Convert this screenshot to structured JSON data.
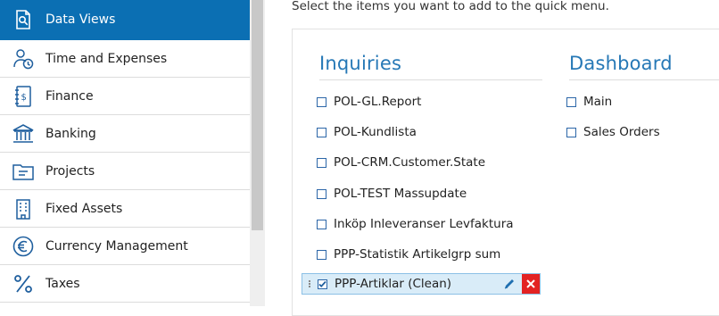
{
  "sidebar": {
    "items": [
      {
        "label": "Data Views",
        "icon": "data-views-icon",
        "active": true
      },
      {
        "label": "Time and Expenses",
        "icon": "time-expenses-icon"
      },
      {
        "label": "Finance",
        "icon": "finance-icon"
      },
      {
        "label": "Banking",
        "icon": "bank-icon"
      },
      {
        "label": "Projects",
        "icon": "projects-icon"
      },
      {
        "label": "Fixed Assets",
        "icon": "building-icon"
      },
      {
        "label": "Currency Management",
        "icon": "euro-icon"
      },
      {
        "label": "Taxes",
        "icon": "percent-icon"
      }
    ],
    "accent": "#0b6fb3"
  },
  "main": {
    "instruction": "Select the items you want to add to the quick menu.",
    "inquiries": {
      "title": "Inquiries",
      "items": [
        {
          "label": "POL-GL.Report",
          "checked": false
        },
        {
          "label": "POL-Kundlista",
          "checked": false
        },
        {
          "label": "POL-CRM.Customer.State",
          "checked": false
        },
        {
          "label": "POL-TEST Massupdate",
          "checked": false
        },
        {
          "label": "Inköp Inleveranser Levfaktura",
          "checked": false
        },
        {
          "label": "PPP-Statistik Artikelgrp sum",
          "checked": false
        },
        {
          "label": "PPP-Artiklar (Clean)",
          "checked": true,
          "selected": true
        }
      ]
    },
    "dashboard": {
      "title": "Dashboard",
      "items": [
        {
          "label": "Main",
          "checked": false
        },
        {
          "label": "Sales Orders",
          "checked": false
        }
      ]
    },
    "title_color": "#2678b6",
    "delete_color": "#e32222"
  }
}
